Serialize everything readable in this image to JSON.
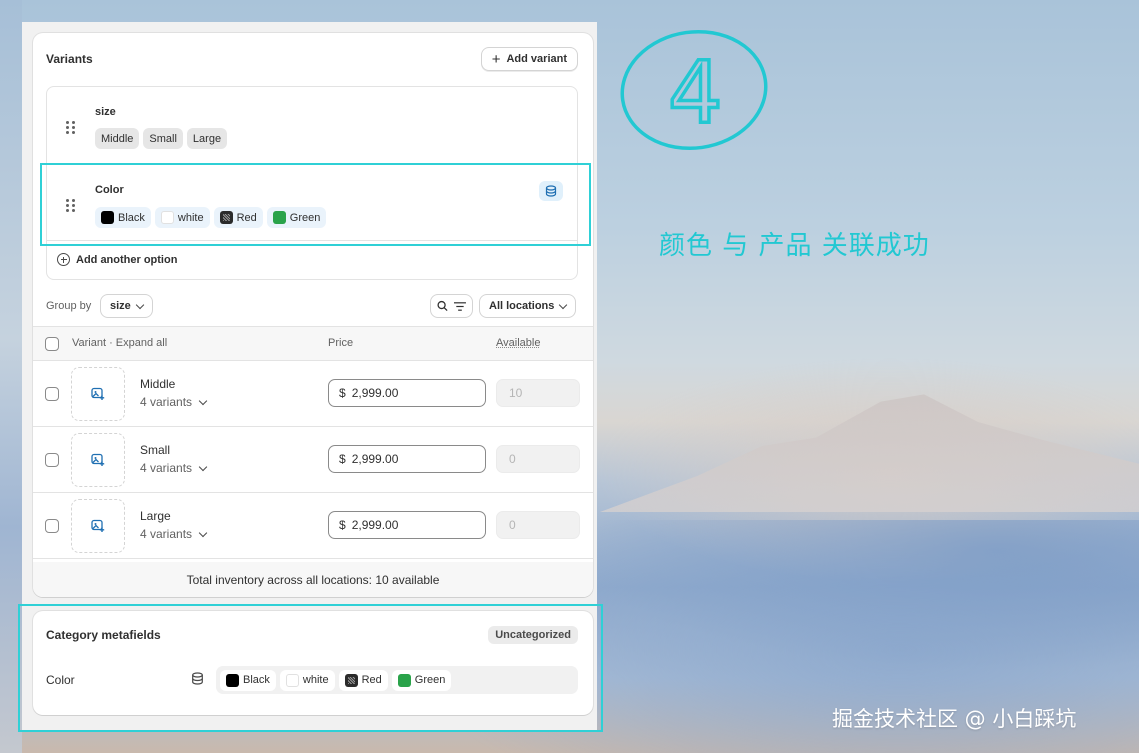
{
  "variants": {
    "title": "Variants",
    "add_variant_label": "Add variant",
    "options": [
      {
        "name": "size",
        "values": [
          "Middle",
          "Small",
          "Large"
        ]
      },
      {
        "name": "Color",
        "values": [
          {
            "label": "Black",
            "swatch": "#000000"
          },
          {
            "label": "white",
            "swatch": "#ffffff"
          },
          {
            "label": "Red",
            "swatch": "pattern"
          },
          {
            "label": "Green",
            "swatch": "#2aa34a"
          }
        ]
      }
    ],
    "add_option_label": "Add another option",
    "group_by_label": "Group by",
    "group_by_value": "size",
    "locations_label": "All locations",
    "table": {
      "col_variant": "Variant · Expand all",
      "col_price": "Price",
      "col_available": "Available",
      "rows": [
        {
          "name": "Middle",
          "count": "4 variants",
          "currency": "$",
          "price": "2,999.00",
          "available": "10"
        },
        {
          "name": "Small",
          "count": "4 variants",
          "currency": "$",
          "price": "2,999.00",
          "available": "0"
        },
        {
          "name": "Large",
          "count": "4 variants",
          "currency": "$",
          "price": "2,999.00",
          "available": "0"
        }
      ],
      "total": "Total inventory across all locations: 10 available"
    }
  },
  "metafields": {
    "title": "Category metafields",
    "badge": "Uncategorized",
    "field_label": "Color",
    "values": [
      "Black",
      "white",
      "Red",
      "Green"
    ]
  },
  "annotation": {
    "step": "4",
    "text": "颜色 与 产品 关联成功",
    "color": "#22c8d2"
  },
  "watermark": "掘金技术社区 @ 小白踩坑"
}
